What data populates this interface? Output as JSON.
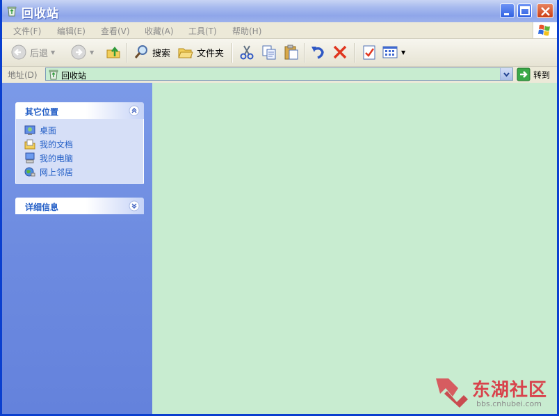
{
  "window": {
    "title": "回收站"
  },
  "menu": {
    "items": [
      "文件(F)",
      "编辑(E)",
      "查看(V)",
      "收藏(A)",
      "工具(T)",
      "帮助(H)"
    ]
  },
  "toolbar": {
    "back_label": "后退",
    "search_label": "搜索",
    "folders_label": "文件夹"
  },
  "address": {
    "label": "地址(D)",
    "value": "回收站",
    "go_label": "转到"
  },
  "taskpane": {
    "other_places": {
      "title": "其它位置",
      "links": [
        "桌面",
        "我的文档",
        "我的电脑",
        "网上邻居"
      ]
    },
    "details": {
      "title": "详细信息"
    }
  },
  "watermark": {
    "name": "东湖社区",
    "url": "bbs.cnhubei.com"
  },
  "colors": {
    "content_bg": "#c8ecd0",
    "pane_blue": "#6d8be0",
    "link_blue": "#215dc6"
  }
}
